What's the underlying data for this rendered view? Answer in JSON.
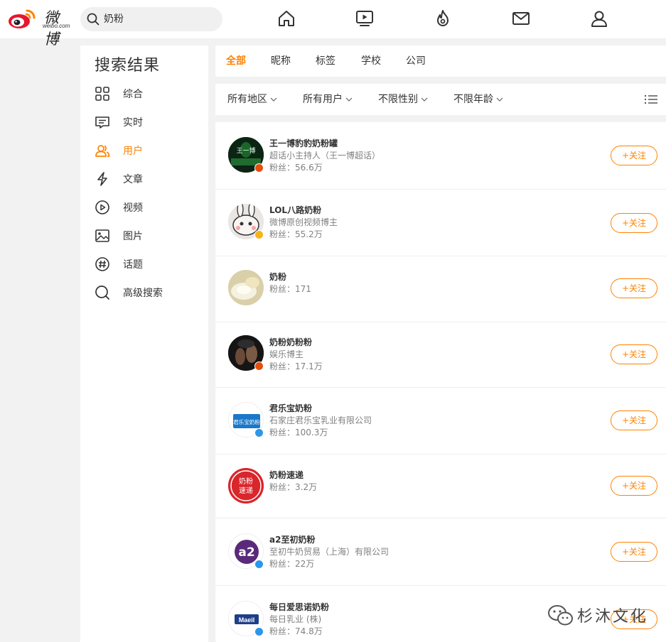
{
  "brand": {
    "logo_text": "微博",
    "logo_sub": "weibo.com",
    "accent": "#ff8200"
  },
  "search": {
    "query": "奶粉"
  },
  "nav_icons": [
    "home-icon",
    "video-icon",
    "hot-icon",
    "mail-icon",
    "profile-icon"
  ],
  "sidebar": {
    "title": "搜索结果",
    "items": [
      {
        "label": "综合",
        "icon": "grid-icon"
      },
      {
        "label": "实时",
        "icon": "message-icon"
      },
      {
        "label": "用户",
        "icon": "users-icon",
        "active": true
      },
      {
        "label": "文章",
        "icon": "article-icon"
      },
      {
        "label": "视频",
        "icon": "play-icon"
      },
      {
        "label": "图片",
        "icon": "image-icon"
      },
      {
        "label": "话题",
        "icon": "topic-icon"
      },
      {
        "label": "高级搜索",
        "icon": "search-icon"
      }
    ]
  },
  "tabs": [
    {
      "label": "全部",
      "active": true
    },
    {
      "label": "昵称"
    },
    {
      "label": "标签"
    },
    {
      "label": "学校"
    },
    {
      "label": "公司"
    }
  ],
  "filters": [
    {
      "label": "所有地区"
    },
    {
      "label": "所有用户"
    },
    {
      "label": "不限性别"
    },
    {
      "label": "不限年龄"
    }
  ],
  "users": [
    {
      "name": "王一博豹豹奶粉罐",
      "desc": "超话小主持人（王一博超话）",
      "fans": "粉丝：56.6万",
      "badge": "#e54e0e",
      "follow": "+关注"
    },
    {
      "name": "LOL八路奶粉",
      "desc": "微博原创视频博主",
      "fans": "粉丝：55.2万",
      "badge": "#f6b31b",
      "follow": "+关注"
    },
    {
      "name": "奶粉",
      "desc": "",
      "fans": "粉丝：171",
      "badge": "",
      "follow": "+关注"
    },
    {
      "name": "奶粉奶粉粉",
      "desc": "娱乐博主",
      "fans": "粉丝：17.1万",
      "badge": "#e54e0e",
      "follow": "+关注"
    },
    {
      "name": "君乐宝奶粉",
      "desc": "石家庄君乐宝乳业有限公司",
      "fans": "粉丝：100.3万",
      "badge": "#2d96e8",
      "follow": "+关注"
    },
    {
      "name": "奶粉速递",
      "desc": "",
      "fans": "粉丝：3.2万",
      "badge": "",
      "follow": "+关注"
    },
    {
      "name": "a2至初奶粉",
      "desc": "至初牛奶贸易（上海）有限公司",
      "fans": "粉丝：22万",
      "badge": "#2d96e8",
      "follow": "+关注"
    },
    {
      "name": "每日爱思诺奶粉",
      "desc": "每日乳业 (株)",
      "fans": "粉丝：74.8万",
      "badge": "#2d96e8",
      "follow": "+关注"
    }
  ],
  "avatar_texts": {
    "wang": "王一博",
    "junlebao": "君乐宝奶粉",
    "sudi_1": "奶粉",
    "sudi_2": "速递",
    "a2": "a2",
    "maeil": "Maeil"
  },
  "watermark": {
    "text": "杉沐文化"
  }
}
